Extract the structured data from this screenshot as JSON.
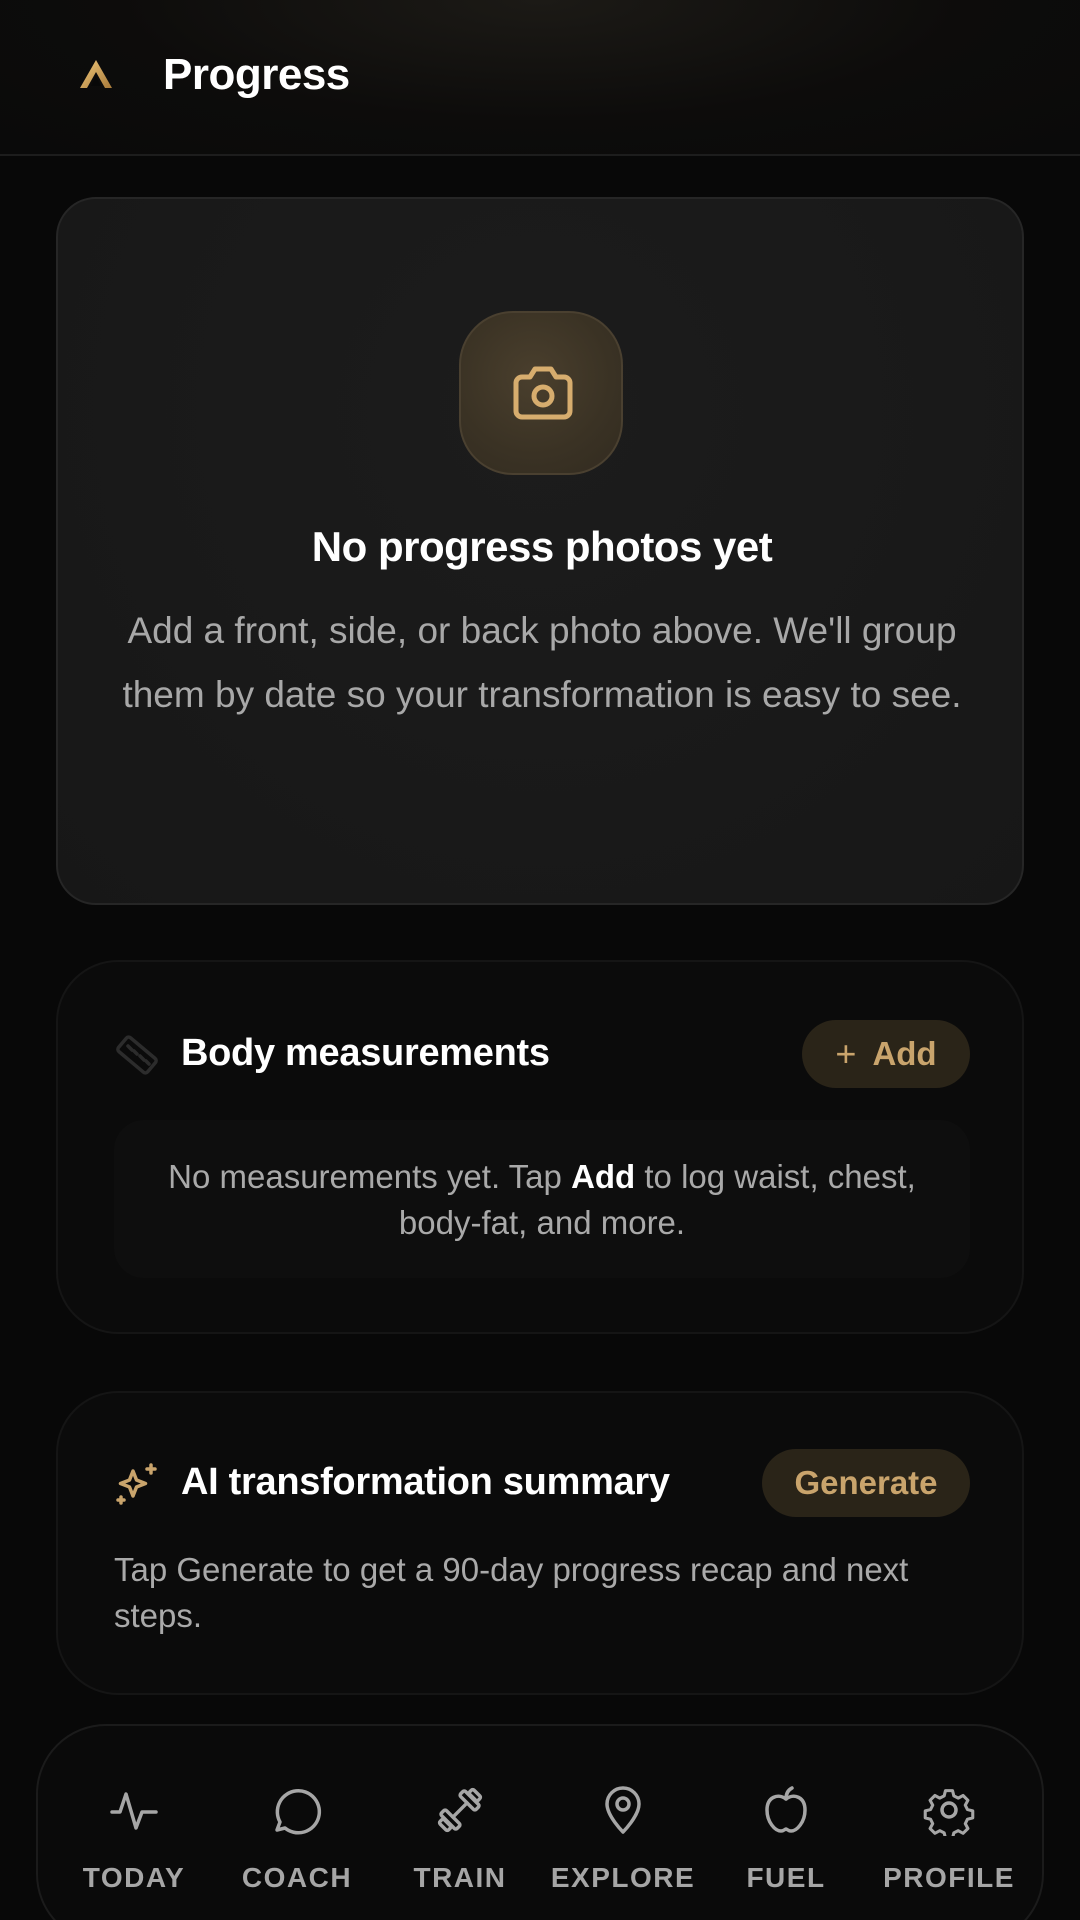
{
  "header": {
    "title": "Progress"
  },
  "photos": {
    "empty_title": "No progress photos yet",
    "empty_body": "Add a front, side, or back photo above. We'll group them by date so your transformation is easy to see."
  },
  "measurements": {
    "title": "Body measurements",
    "add_label": "Add",
    "empty_before": "No measurements yet. Tap ",
    "empty_bold": "Add",
    "empty_after": " to log waist, chest, body-fat, and more."
  },
  "ai_summary": {
    "title": "AI transformation summary",
    "generate_label": "Generate",
    "body": "Tap Generate to get a 90-day progress recap and next steps."
  },
  "nav": {
    "items": [
      {
        "label": "TODAY",
        "icon": "activity-icon"
      },
      {
        "label": "COACH",
        "icon": "chat-bubble-icon"
      },
      {
        "label": "TRAIN",
        "icon": "dumbbell-icon"
      },
      {
        "label": "EXPLORE",
        "icon": "map-pin-icon"
      },
      {
        "label": "FUEL",
        "icon": "apple-icon"
      },
      {
        "label": "PROFILE",
        "icon": "gear-icon"
      }
    ]
  },
  "colors": {
    "accent": "#c9a46c",
    "background": "#080808",
    "card": "#191919",
    "muted_text": "#a8a8a8"
  }
}
